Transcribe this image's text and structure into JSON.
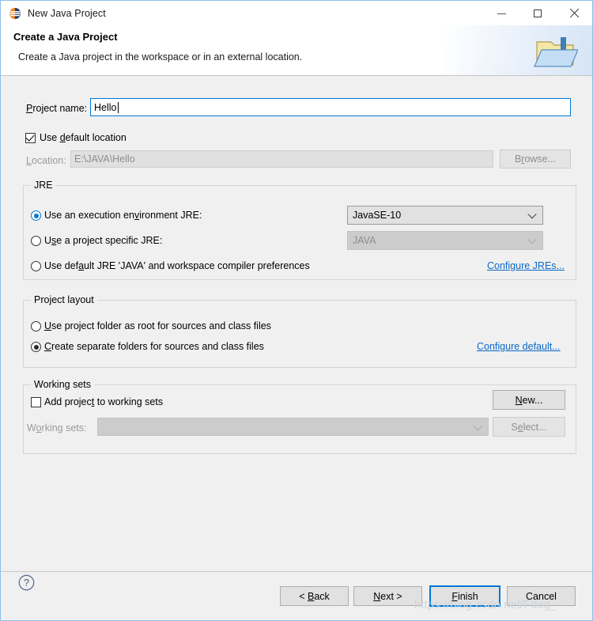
{
  "window": {
    "title": "New Java Project",
    "icon": "eclipse-icon",
    "controls": {
      "minimize": "minimize-icon",
      "maximize": "maximize-icon",
      "close": "close-icon"
    }
  },
  "banner": {
    "title": "Create a Java Project",
    "subtitle": "Create a Java project in the workspace or in an external location.",
    "icon": "new-project-folder-icon"
  },
  "project": {
    "name_label": "Project name:",
    "name_value": "Hello",
    "name_placeholder": "",
    "use_default_location_label": "Use default location",
    "use_default_location_checked": true,
    "location_label": "Location:",
    "location_value": "E:\\JAVA\\Hello",
    "browse_label": "Browse...",
    "browse_enabled": false
  },
  "jre": {
    "group_title": "JRE",
    "options": [
      {
        "label": "Use an execution environment JRE:",
        "selected": true,
        "combo_value": "JavaSE-10",
        "combo_enabled": true
      },
      {
        "label": "Use a project specific JRE:",
        "selected": false,
        "combo_value": "JAVA",
        "combo_enabled": false
      },
      {
        "label": "Use default JRE 'JAVA' and workspace compiler preferences",
        "selected": false
      }
    ],
    "configure_link": "Configure JREs..."
  },
  "project_layout": {
    "group_title": "Project layout",
    "options": [
      {
        "label": "Use project folder as root for sources and class files",
        "selected": false
      },
      {
        "label": "Create separate folders for sources and class files",
        "selected": true
      }
    ],
    "configure_link": "Configure default..."
  },
  "working_sets": {
    "group_title": "Working sets",
    "add_label": "Add project to working sets",
    "add_checked": false,
    "sets_label": "Working sets:",
    "sets_value": "",
    "new_label": "New...",
    "new_enabled": true,
    "select_label": "Select...",
    "select_enabled": false
  },
  "footer": {
    "help": "help-icon",
    "back_label": "< Back",
    "next_label": "Next >",
    "finish_label": "Finish",
    "cancel_label": "Cancel",
    "default_button": "Finish"
  },
  "watermark": "https://blog.csdn.net/Fdog_",
  "colors": {
    "accent": "#0078d7",
    "link": "#0b68c8",
    "dialog_bg": "#f0f0f0",
    "border": "#8fbde8"
  }
}
